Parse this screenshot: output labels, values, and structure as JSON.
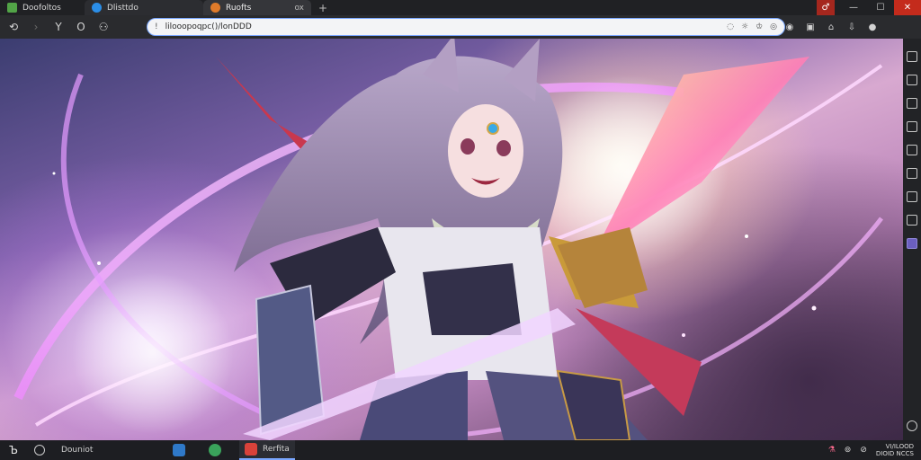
{
  "tabs": [
    {
      "label": "Doofoltos",
      "icon": "green-puzzle-icon",
      "color": "#52a447"
    },
    {
      "label": "Dlisttdo",
      "icon": "blue-cloud-icon",
      "color": "#2b8ee8"
    },
    {
      "label": "Ruofts",
      "icon": "orange-sun-icon",
      "color": "#e07b2a"
    }
  ],
  "active_tab_suffix": "ox",
  "new_tab": "+",
  "window": {
    "minimize": "—",
    "maximize": "☐",
    "close": "✕"
  },
  "toolbar": {
    "back": "⟲",
    "forward": "›",
    "reload": "Y",
    "home": "O",
    "extension": "⚇"
  },
  "address": {
    "lock": "!",
    "url": "lilooopoqpc()/lonDDD"
  },
  "omnibox_icons": [
    "◌",
    "☼",
    "♔",
    "◎"
  ],
  "toolbar_right": [
    "◉",
    "▣",
    "⌂",
    "⇩",
    "●"
  ],
  "taskbar": {
    "start": "Ъ",
    "search_label": "Douniot",
    "apps": [
      {
        "label": "",
        "color": "#2f79c9"
      },
      {
        "label": "",
        "color": "#3aa35b"
      },
      {
        "label": "Rerfita",
        "color": "#d8423a"
      }
    ],
    "tray": [
      "⚗",
      "⊚",
      "⊘"
    ],
    "clock_line1": "VI/ILOOD",
    "clock_line2": "DIOID NCCS"
  },
  "colors": {
    "accent": "#7aa7ff",
    "close": "#c42b1c",
    "ext": "#a5271e"
  }
}
